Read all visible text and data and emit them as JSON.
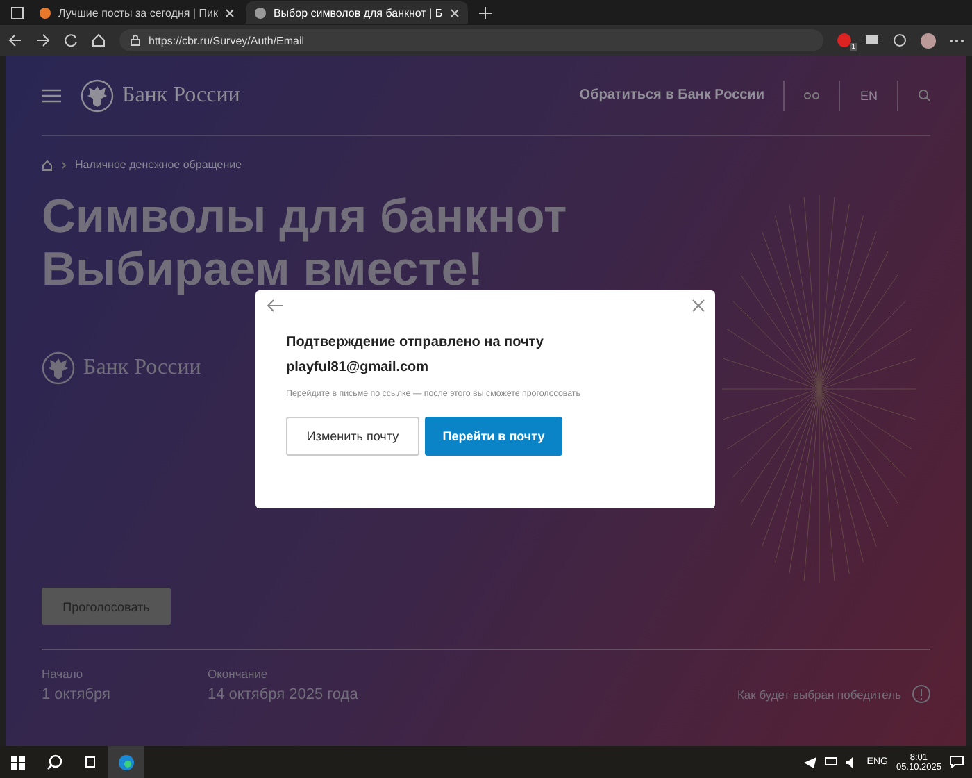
{
  "browser": {
    "tabs": [
      {
        "title": "Лучшие посты за сегодня | Пик",
        "selected": false
      },
      {
        "title": "Выбор символов для банкнот | Б",
        "selected": true
      }
    ],
    "url": "https://cbr.ru/Survey/Auth/Email",
    "extension_badge": "1"
  },
  "header": {
    "logo": "Банк России",
    "contact": "Обратиться в Банк России",
    "language": "EN"
  },
  "breadcrumb": [
    "Наличное денежное обращение"
  ],
  "title_lines": [
    "Символы для банкнот",
    "Выбираем вместе!"
  ],
  "logo_secondary": "Банк России",
  "vote_button": "Проголосовать",
  "dates": [
    {
      "label": "Начало",
      "value": "1 октября"
    },
    {
      "label": "Окончание",
      "value": "14 октября 2025 года"
    }
  ],
  "winner_link": "Как будет выбран победитель",
  "modal": {
    "heading": "Подтверждение отправлено на почту",
    "email": "playful81@gmail.com",
    "hint": "Перейдите в письме по ссылке — после этого вы сможете проголосовать",
    "buttons": [
      {
        "label": "Изменить почту",
        "kind": "secondary"
      },
      {
        "label": "Перейти в почту",
        "kind": "primary"
      }
    ]
  },
  "taskbar": {
    "language": "ENG",
    "time": "8:01",
    "date": "05.10.2025"
  }
}
